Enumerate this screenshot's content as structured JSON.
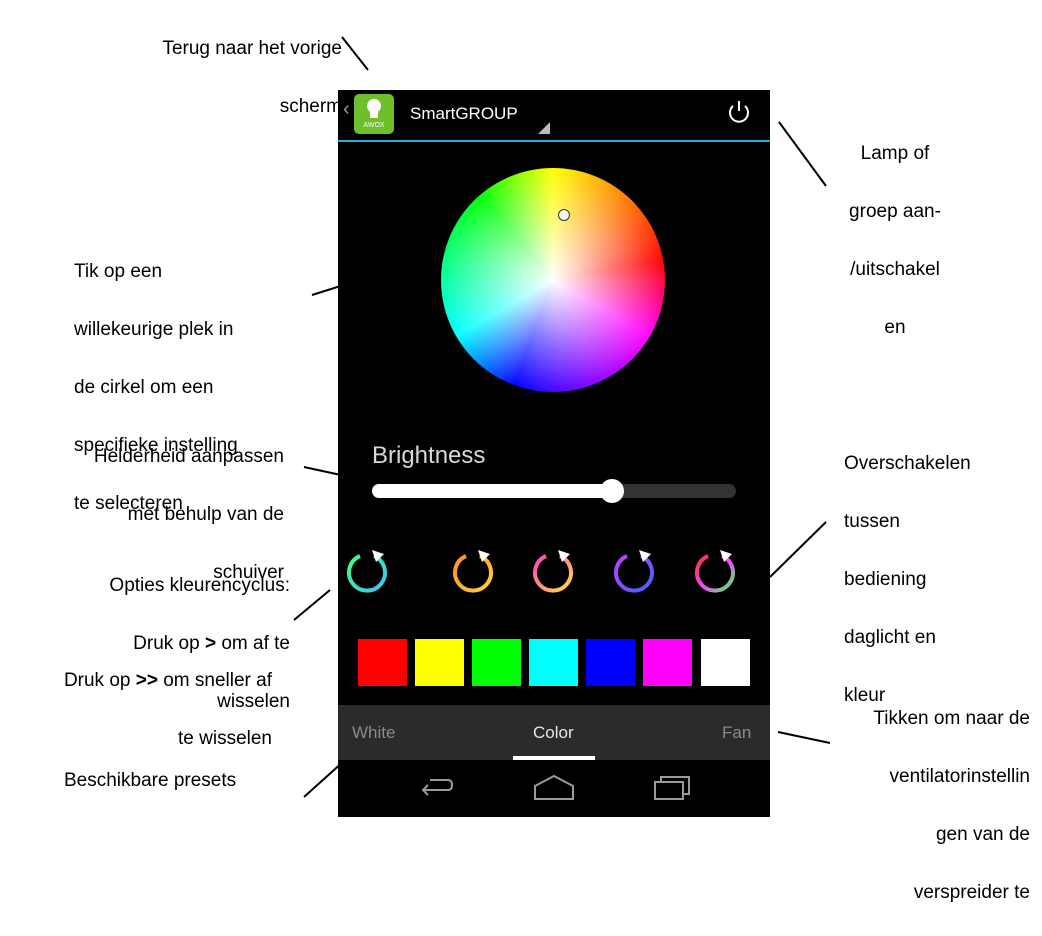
{
  "phone": {
    "app_icon_text": "AWOX",
    "title": "SmartGROUP",
    "brightness_label": "Brightness",
    "brightness_level": 0.66,
    "tabs": [
      {
        "label": "White",
        "color": "#8a8a8a"
      },
      {
        "label": "Color",
        "color": "#e6e6e6"
      },
      {
        "label": "Fan",
        "color": "#8a8a8a"
      }
    ],
    "active_tab": "Color",
    "presets": [
      "#ff0000",
      "#ffff00",
      "#00ff00",
      "#00ffff",
      "#0000ff",
      "#ff00ff",
      "#ffffff"
    ],
    "cycle_icons": [
      "cycle-green-blue",
      "cycle-orange-yellow",
      "cycle-pink-yellow",
      "cycle-purple-blue",
      "cycle-rainbow"
    ],
    "nav_icons": [
      "back-icon",
      "home-icon",
      "recents-icon"
    ]
  },
  "annotations": {
    "back": [
      "Terug naar het vorige",
      "scherm"
    ],
    "power": [
      "Lamp of",
      "groep aan-",
      "/uitschakel",
      "en"
    ],
    "wheel": [
      "Tik op een",
      "willekeurige plek in",
      "de cirkel om een",
      "specifieke instelling",
      "te selecteren"
    ],
    "brightness": [
      "Helderheid aanpassen",
      "met behulp van de",
      "schuiver"
    ],
    "cycle_title": "Opties kleurencyclus:",
    "cycle_1a": "Druk op ",
    "cycle_1b": ">",
    "cycle_1c": " om af te",
    "cycle_1d": "wisselen",
    "cycle_2a": "Druk op ",
    "cycle_2b": ">>",
    "cycle_2c": " om sneller af",
    "cycle_2d": "te wisselen",
    "switch": [
      "Overschakelen",
      "tussen",
      "bediening",
      "daglicht en",
      "kleur"
    ],
    "fan": [
      "Tikken om naar de",
      "ventilatorinstellin",
      "gen van de",
      "verspreider te"
    ],
    "presets": "Beschikbare presets"
  }
}
